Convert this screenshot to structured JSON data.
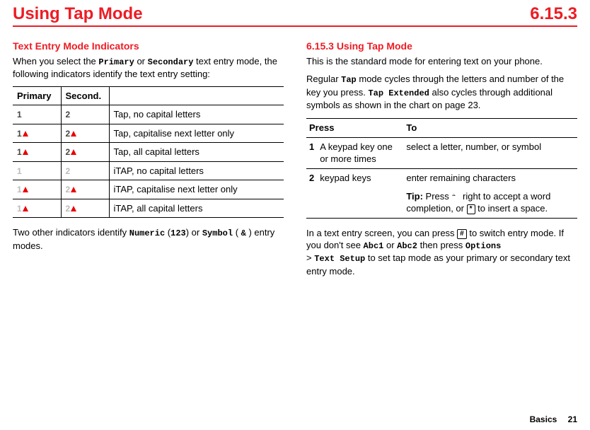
{
  "header": {
    "title": "Using Tap Mode",
    "section": "6.15.3"
  },
  "left": {
    "subhead": "Text Entry Mode Indicators",
    "intro_pre": "When you select the ",
    "intro_primary": "Primary",
    "intro_mid": " or ",
    "intro_secondary": "Secondary",
    "intro_post": " text entry mode, the following indicators identify the text entry setting:",
    "table": {
      "head_primary": "Primary",
      "head_second": "Second.",
      "rows": [
        {
          "desc": "Tap, no capital letters"
        },
        {
          "desc": "Tap, capitalise next letter only"
        },
        {
          "desc": "Tap, all capital letters"
        },
        {
          "desc": "iTAP, no capital letters"
        },
        {
          "desc": "iTAP, capitalise next letter only"
        },
        {
          "desc": "iTAP, all capital letters"
        }
      ]
    },
    "post_pre": "Two other indicators identify ",
    "post_numeric": "Numeric",
    "post_mid1": " (",
    "post_numeric_icon": "123",
    "post_mid2": ") or ",
    "post_symbol": "Symbol",
    "post_mid3": " ( ",
    "post_symbol_icon": "&",
    "post_end": " ) entry modes."
  },
  "right": {
    "subhead": "6.15.3 Using Tap Mode",
    "p1": "This is the standard mode for entering text on your phone.",
    "p2_pre": "Regular ",
    "p2_tap": "Tap",
    "p2_mid": " mode cycles through the letters and number of the key you press. ",
    "p2_tapext": "Tap Extended",
    "p2_post": " also cycles through additional symbols as shown in the chart on page 23.",
    "table": {
      "head_press": "Press",
      "head_to": "To",
      "row1_num": "1",
      "row1_press": "A keypad key one or more times",
      "row1_to": "select a letter, number, or symbol",
      "row2_num": "2",
      "row2_press": "keypad keys",
      "row2_to": "enter remaining characters",
      "tip_label": "Tip:",
      "tip_pre": " Press ",
      "tip_mid": " right to accept a word completion, or ",
      "tip_key": "*",
      "tip_post": " to insert a space."
    },
    "p3_pre": "In a text entry screen, you can press ",
    "p3_key": "#",
    "p3_mid1": " to switch entry mode. If you don't see ",
    "p3_abc1": "Abc1",
    "p3_mid2": " or ",
    "p3_abc2": "Abc2",
    "p3_mid3": " then press ",
    "p3_options": "Options",
    "p3_gt": " > ",
    "p3_textsetup": "Text Setup",
    "p3_post": " to set tap mode as your primary or secondary text entry mode."
  },
  "footer": {
    "basics": "Basics",
    "page": "21"
  }
}
